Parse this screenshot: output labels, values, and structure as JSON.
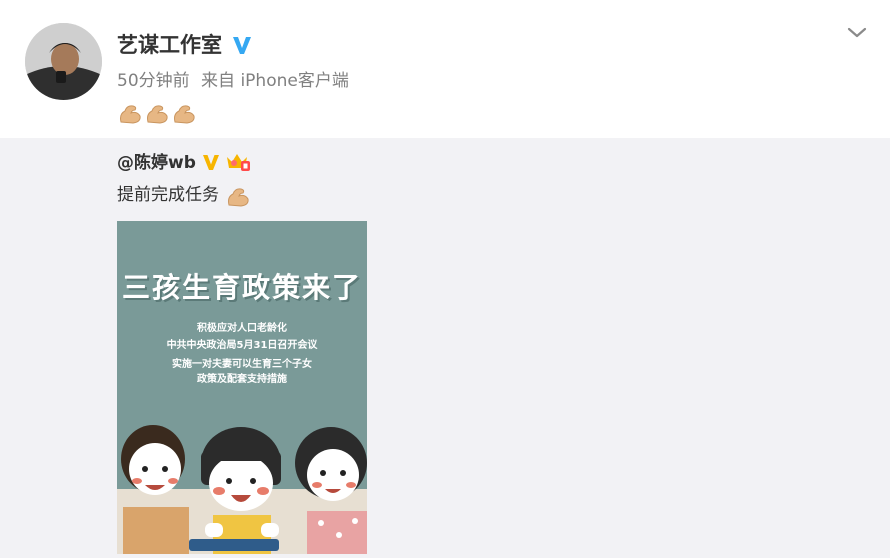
{
  "post": {
    "author": "艺谋工作室",
    "time": "50分钟前",
    "source": "来自 iPhone客户端",
    "emoji": "flexed-biceps-emoji"
  },
  "repost": {
    "author": "@陈婷wb",
    "text": "提前完成任务",
    "image": {
      "title": "三孩生育政策来了",
      "lines": [
        "积极应对人口老龄化",
        "中共中央政治局5月31日召开会议",
        "实施一对夫妻可以生育三个子女",
        "政策及配套支持措施"
      ]
    }
  },
  "colors": {
    "verified": "#35a8f2",
    "gold": "#f7b500",
    "repost_bg": "#f2f2f5",
    "poster_bg": "#7a9a98"
  },
  "icons": [
    "avatar",
    "verified-icon",
    "chevron-down-icon",
    "flexed-biceps-emoji",
    "crown-icon"
  ]
}
